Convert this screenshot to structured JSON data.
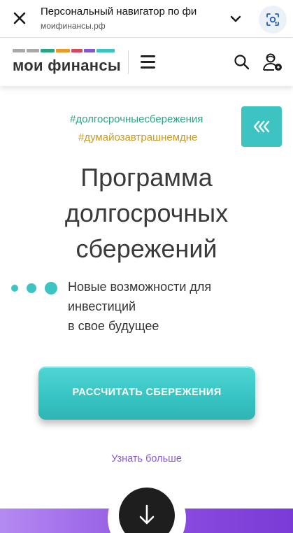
{
  "browser": {
    "title": "Персональный навигатор по фи",
    "url": "моифинансы.рф"
  },
  "header": {
    "logo_text": "мои финансы",
    "logo_stripe_colors": [
      "#a9a9a9",
      "#a9a9a9",
      "#2aa386",
      "#e89a2a",
      "#d14a5d",
      "#7e5bd0",
      "#3ec3c3"
    ]
  },
  "hero": {
    "hashtag_1": "#долгосрочныесбережения",
    "hashtag_2": "#думайозавтрашнемдне",
    "title_line_1": "Программа",
    "title_line_2": "долгосрочных",
    "title_line_3": "сбережений",
    "subtitle_line_1": "Новые возможности для",
    "subtitle_line_2": "инвестиций",
    "subtitle_line_3": "в свое будущее",
    "cta_label": "РАССЧИТАТЬ СБЕРЕЖЕНИЯ",
    "learn_more": "Узнать больше"
  },
  "colors": {
    "accent_teal": "#3ec3c3",
    "hashtag_green": "#2aa386",
    "hashtag_gold": "#c99a1e",
    "link_purple": "#8b5bd6",
    "band_purple": "#8a4be0"
  },
  "icons": {
    "close": "close-icon",
    "chevron": "chevron-down-icon",
    "lens": "google-lens-icon",
    "menu": "hamburger-menu-icon",
    "search": "search-icon",
    "user": "user-account-icon",
    "collapse": "chevrons-left-icon",
    "scroll_down": "arrow-down-icon"
  }
}
